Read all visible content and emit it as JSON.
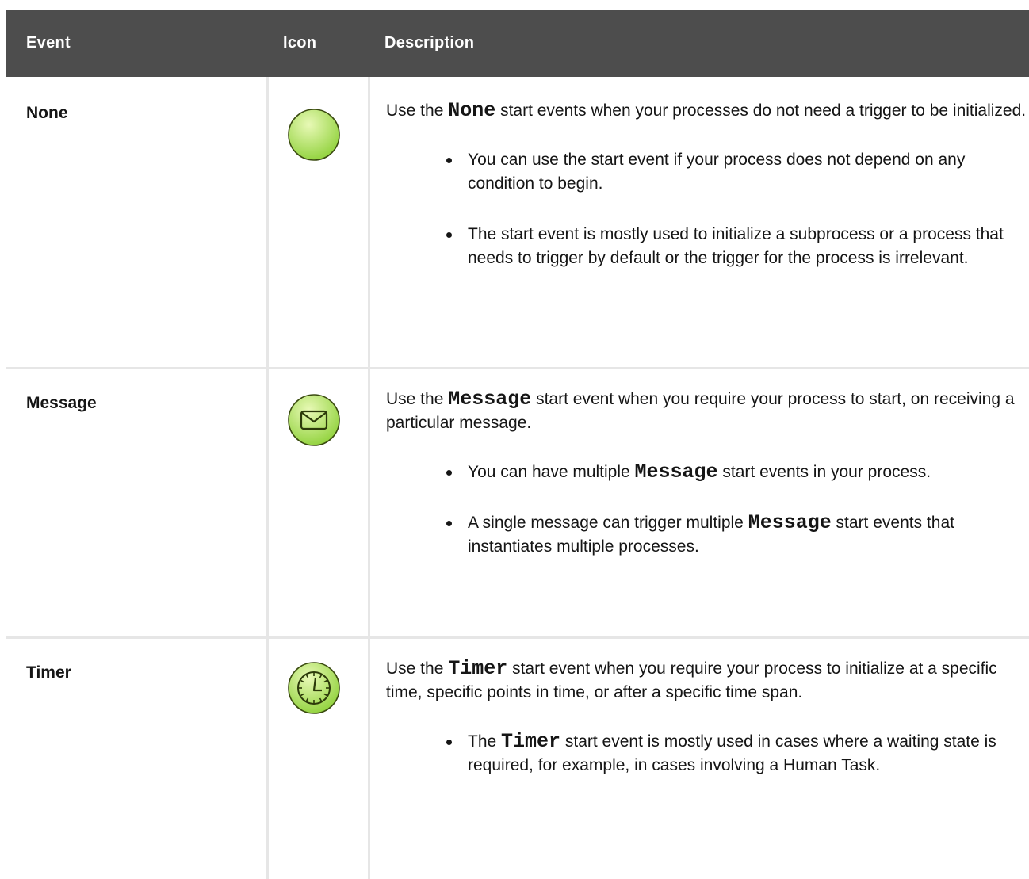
{
  "table": {
    "headers": {
      "event": "Event",
      "icon": "Icon",
      "description": "Description"
    },
    "rows": [
      {
        "event": "None",
        "icon": "none-start-event-icon",
        "description": {
          "pre": "Use the ",
          "code": "None",
          "post": " start events when your processes do not need a trigger to be initialized."
        },
        "bullets": [
          {
            "pre": "You can use the start event if your process does not depend on any condition to begin.",
            "code": "",
            "post": ""
          },
          {
            "pre": "The start event is mostly used to initialize a subprocess or a process that needs to trigger by default or the trigger for the process is irrelevant.",
            "code": "",
            "post": ""
          }
        ]
      },
      {
        "event": "Message",
        "icon": "message-start-event-icon",
        "description": {
          "pre": "Use the ",
          "code": "Message",
          "post": " start event when you require your process to start, on receiving a particular message."
        },
        "bullets": [
          {
            "pre": "You can have multiple ",
            "code": "Message",
            "post": " start events in your process."
          },
          {
            "pre": "A single message can trigger multiple ",
            "code": "Message",
            "post": " start events that instantiates multiple processes."
          }
        ]
      },
      {
        "event": "Timer",
        "icon": "timer-start-event-icon",
        "description": {
          "pre": "Use the ",
          "code": "Timer",
          "post": " start event when you require your process to initialize at a specific time, specific points in time, or after a specific time span."
        },
        "bullets": [
          {
            "pre": "The ",
            "code": "Timer",
            "post": " start event is mostly used in cases where a waiting state is required, for example, in cases involving a Human Task."
          }
        ]
      }
    ]
  },
  "colors": {
    "header_bg": "#4d4d4d",
    "header_text": "#ffffff",
    "grid_line": "#e6e6e6",
    "icon_fill_light": "#dff5a8",
    "icon_fill_dark": "#8fd13a",
    "icon_stroke": "#3a4a10"
  }
}
